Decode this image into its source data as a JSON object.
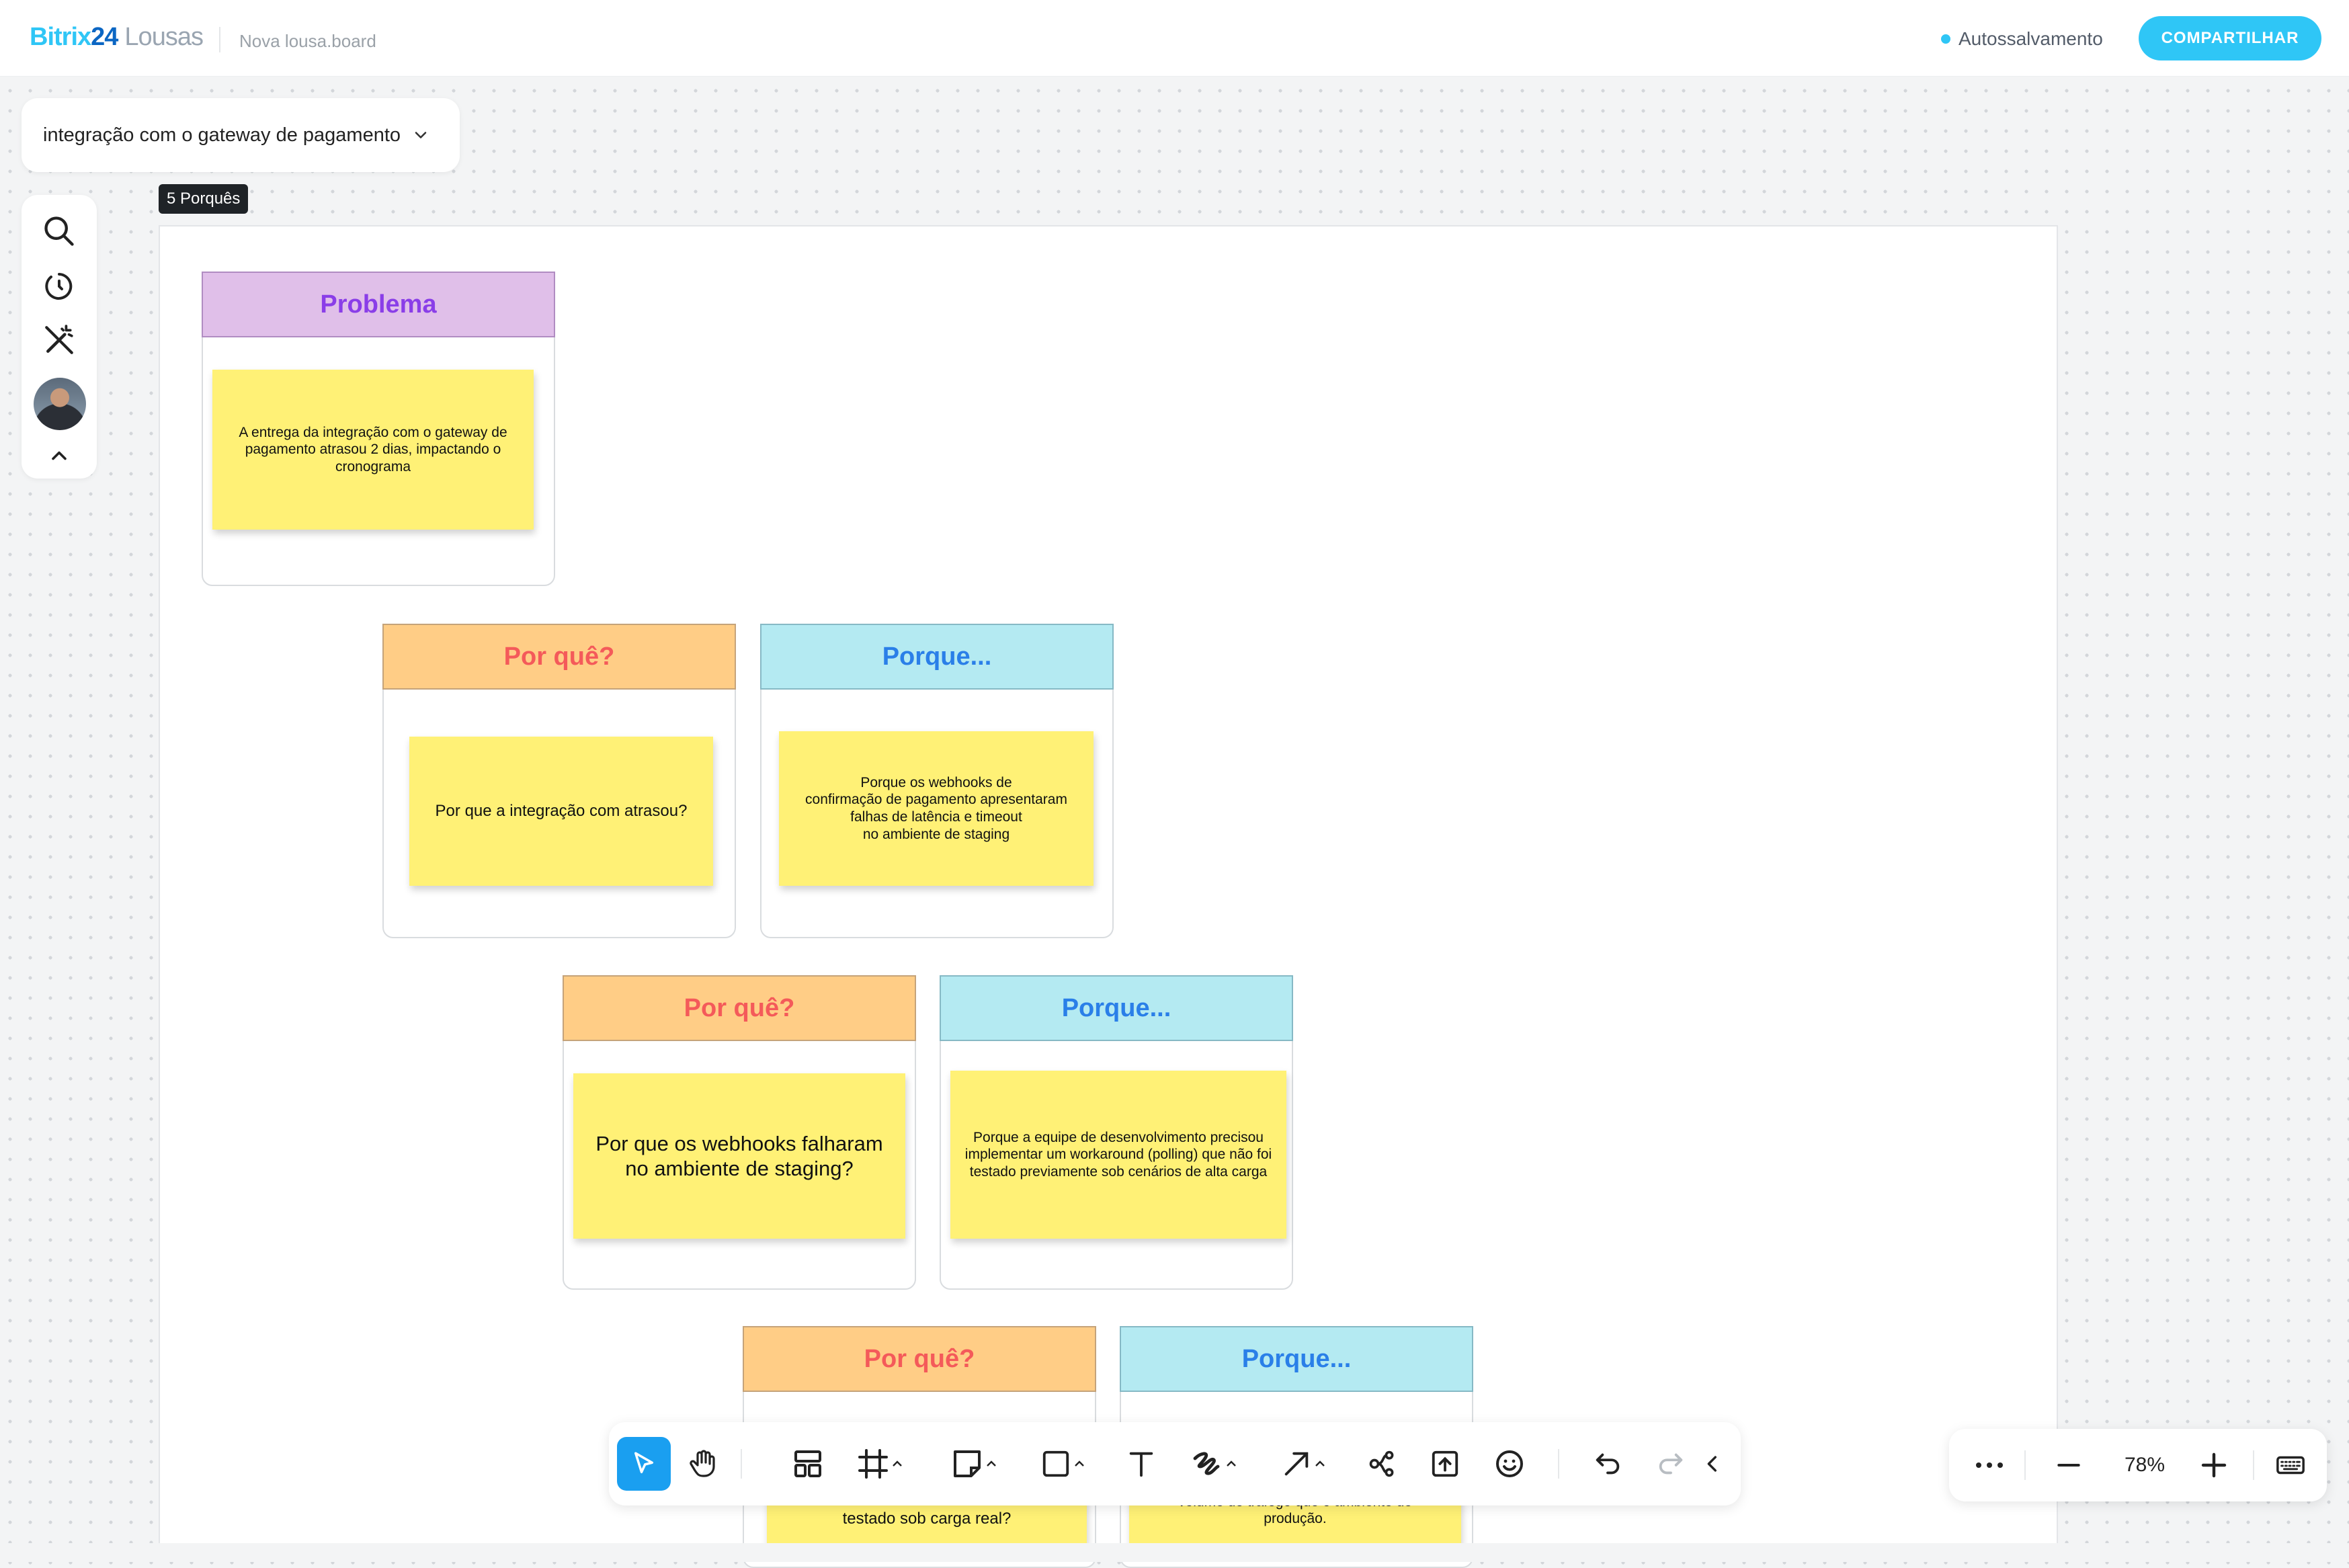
{
  "header": {
    "logo_part1": "Bitrix",
    "logo_part2": "24",
    "logo_product": "Lousas",
    "board_name": "Nova lousa.board",
    "autosave_label": "Autossalvamento",
    "share_label": "COMPARTILHAR"
  },
  "frame_selector": {
    "label": "integração com o gateway de pagamento",
    "icon": "chevron-down-icon"
  },
  "left_tools": [
    {
      "name": "search-icon"
    },
    {
      "name": "history-icon"
    },
    {
      "name": "magic-wand-off-icon"
    },
    {
      "name": "avatar"
    },
    {
      "name": "chevron-up-icon"
    }
  ],
  "frame_label": "5 Porquês",
  "cards": {
    "problem": {
      "title": "Problema",
      "text": "A entrega da integração com o gateway de pagamento atrasou 2 dias, impactando o cronograma"
    },
    "why1": {
      "title": "Por quê?",
      "text": "Por que a integração com atrasou?"
    },
    "because1": {
      "title": "Porque...",
      "text": "Porque os webhooks de\nconfirmação de pagamento apresentaram\nfalhas de latência e timeout\nno ambiente de staging"
    },
    "why2": {
      "title": "Por quê?",
      "text": "Por que os webhooks falharam no ambiente de staging?"
    },
    "because2": {
      "title": "Porque...",
      "text": "Porque a equipe de desenvolvimento precisou implementar um workaround (polling) que não foi testado previamente sob cenários de alta carga"
    },
    "why3": {
      "title": "Por quê?",
      "text": "testado sob carga real?"
    },
    "because3": {
      "title": "Porque...",
      "text": "volume de tráfego que o ambiente de\nprodução."
    }
  },
  "toolbar": {
    "tools": [
      "pointer-icon",
      "hand-icon",
      "templates-icon",
      "frame-icon",
      "sticky-note-icon",
      "shape-icon",
      "text-icon",
      "pen-icon",
      "arrow-icon",
      "mindmap-icon",
      "upload-icon",
      "emoji-icon",
      "undo-icon",
      "redo-icon",
      "collapse-icon"
    ],
    "selected": "pointer-icon"
  },
  "zoom": {
    "value": "78%",
    "more_icon": "more-icon",
    "minus_icon": "zoom-out-icon",
    "plus_icon": "zoom-in-icon",
    "keyboard_icon": "keyboard-icon"
  },
  "colors": {
    "accent": "#2fc6f6",
    "selected_tool": "#1a9ff0",
    "sticky": "#fff176",
    "problem_header": "#e0bfe9",
    "why_header": "#ffcd86",
    "because_header": "#b4eaf2"
  }
}
